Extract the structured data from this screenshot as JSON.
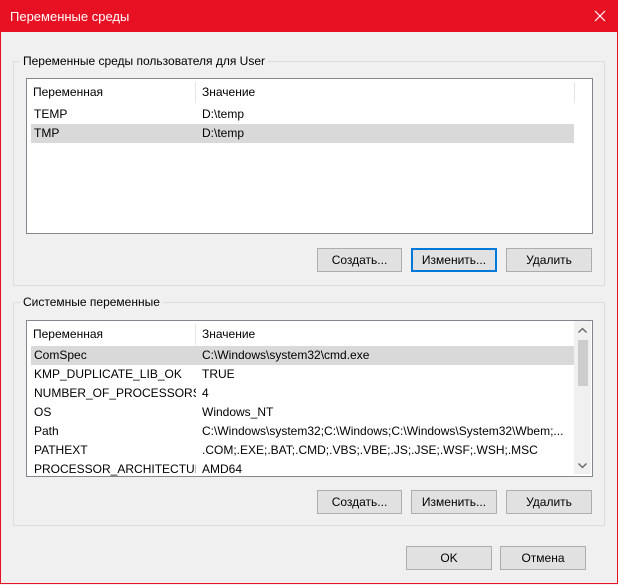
{
  "window": {
    "title": "Переменные среды",
    "accent": "#e81123"
  },
  "user_vars": {
    "legend": "Переменные среды пользователя для User",
    "columns": [
      "Переменная",
      "Значение"
    ],
    "rows": [
      {
        "name": "TEMP",
        "value": "D:\\temp"
      },
      {
        "name": "TMP",
        "value": "D:\\temp"
      }
    ],
    "selected_row": "TMP",
    "buttons": {
      "create": "Создать...",
      "edit": "Изменить...",
      "delete": "Удалить"
    }
  },
  "system_vars": {
    "legend": "Системные переменные",
    "columns": [
      "Переменная",
      "Значение"
    ],
    "rows": [
      {
        "name": "ComSpec",
        "value": "C:\\Windows\\system32\\cmd.exe"
      },
      {
        "name": "KMP_DUPLICATE_LIB_OK",
        "value": "TRUE"
      },
      {
        "name": "NUMBER_OF_PROCESSORS",
        "value": "4"
      },
      {
        "name": "OS",
        "value": "Windows_NT"
      },
      {
        "name": "Path",
        "value": "C:\\Windows\\system32;C:\\Windows;C:\\Windows\\System32\\Wbem;..."
      },
      {
        "name": "PATHEXT",
        "value": ".COM;.EXE;.BAT;.CMD;.VBS;.VBE;.JS;.JSE;.WSF;.WSH;.MSC"
      },
      {
        "name": "PROCESSOR_ARCHITECTURE",
        "value": "AMD64"
      }
    ],
    "selected_row": "ComSpec",
    "buttons": {
      "create": "Создать...",
      "edit": "Изменить...",
      "delete": "Удалить"
    }
  },
  "footer": {
    "ok": "OK",
    "cancel": "Отмена"
  }
}
